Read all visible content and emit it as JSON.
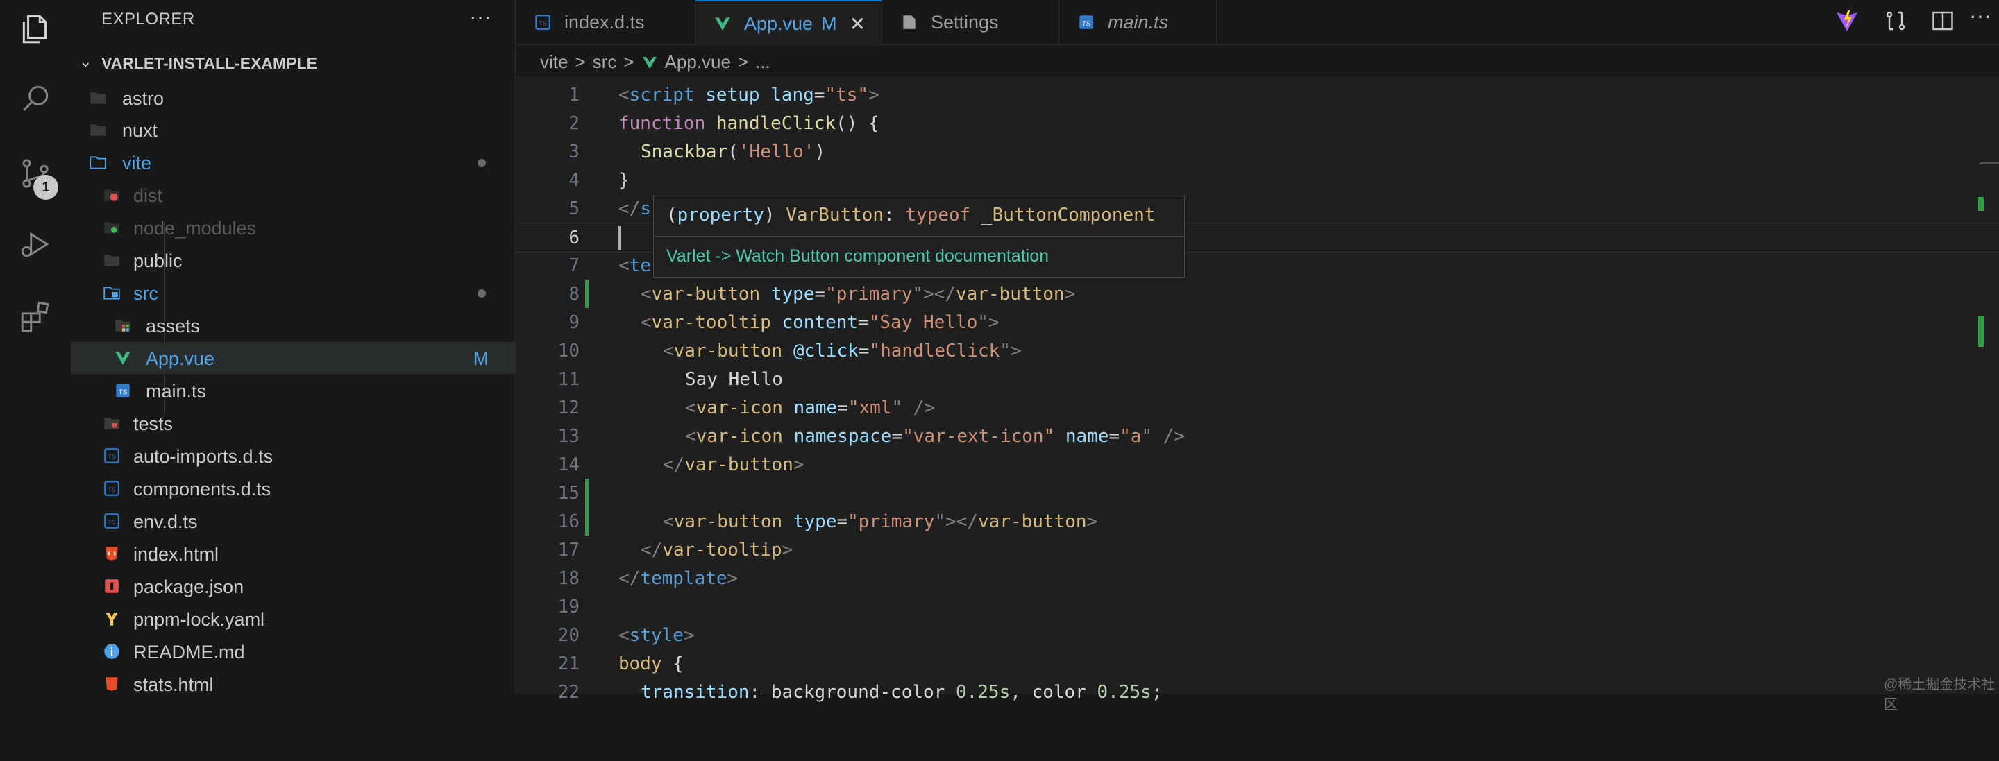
{
  "sidebar": {
    "title": "EXPLORER",
    "more": "···",
    "project": "VARLET-INSTALL-EXAMPLE",
    "items": [
      {
        "label": "astro",
        "icon": "folder-icon"
      },
      {
        "label": "nuxt",
        "icon": "folder-icon"
      },
      {
        "label": "vite",
        "icon": "folder-open-icon",
        "modified": true
      },
      {
        "label": "dist",
        "icon": "folder-dist-icon"
      },
      {
        "label": "node_modules",
        "icon": "folder-node-icon"
      },
      {
        "label": "public",
        "icon": "folder-icon"
      },
      {
        "label": "src",
        "icon": "folder-src-icon",
        "modified": true
      },
      {
        "label": "assets",
        "icon": "folder-assets-icon"
      },
      {
        "label": "App.vue",
        "icon": "vue-icon",
        "status": "M"
      },
      {
        "label": "main.ts",
        "icon": "ts-icon"
      },
      {
        "label": "tests",
        "icon": "folder-tests-icon"
      },
      {
        "label": "auto-imports.d.ts",
        "icon": "ts-icon"
      },
      {
        "label": "components.d.ts",
        "icon": "ts-icon"
      },
      {
        "label": "env.d.ts",
        "icon": "ts-icon"
      },
      {
        "label": "index.html",
        "icon": "html-icon"
      },
      {
        "label": "package.json",
        "icon": "json-icon"
      },
      {
        "label": "pnpm-lock.yaml",
        "icon": "yaml-icon"
      },
      {
        "label": "README.md",
        "icon": "info-icon"
      },
      {
        "label": "stats.html",
        "icon": "html-icon"
      }
    ]
  },
  "activity": {
    "scm_badge": "1"
  },
  "tabs": [
    {
      "label": "index.d.ts",
      "icon": "ts-icon"
    },
    {
      "label": "App.vue",
      "icon": "vue-icon",
      "status": "M",
      "close": "✕"
    },
    {
      "label": "Settings",
      "icon": "settings-file-icon"
    },
    {
      "label": "main.ts",
      "icon": "ts-icon"
    }
  ],
  "breadcrumb": {
    "a": "vite",
    "b": "src",
    "c": "App.vue",
    "d": "...",
    "sep": ">"
  },
  "editor": {
    "line_numbers": [
      "1",
      "2",
      "3",
      "4",
      "5",
      "6",
      "7",
      "8",
      "9",
      "10",
      "11",
      "12",
      "13",
      "14",
      "15",
      "16",
      "17",
      "18",
      "19",
      "20",
      "21",
      "22"
    ],
    "current_line": "6"
  },
  "hover": {
    "sig_paren_open": "(",
    "sig_kind": "property",
    "sig_paren_close": ")",
    "sig_name": "VarButton",
    "sig_colon": ":",
    "sig_typeof": "typeof",
    "sig_type": "_ButtonComponent",
    "link": "Varlet -> Watch Button component documentation"
  },
  "code": {
    "l1": {
      "open": "<",
      "tag": "script",
      "a1": "setup",
      "a2": "lang",
      "eq": "=",
      "q1": "\"",
      "v": "ts",
      "q2": "\"",
      "close": ">"
    },
    "l2": {
      "kw": "function",
      "fn": "handleClick",
      "p": "() {"
    },
    "l3": {
      "fn": "Snackbar",
      "p1": "(",
      "s": "'Hello'",
      "p2": ")"
    },
    "l4": {
      "p": "}"
    },
    "l5": {
      "open": "</",
      "tag": "s"
    },
    "l7": {
      "open": "<",
      "tag": "te"
    },
    "l8": {
      "o": "<",
      "tag": "var-button",
      "attr": "type",
      "eq": "=",
      "q": "\"",
      "val": "primary",
      "m": "\"></",
      "tag2": "var-button",
      "c": ">"
    },
    "l9": {
      "o": "<",
      "tag": "var-tooltip",
      "attr": "content",
      "eq": "=",
      "q": "\"",
      "val": "Say Hello",
      "c": "\">"
    },
    "l10": {
      "o": "<",
      "tag": "var-button",
      "attr": "@click",
      "eq": "=",
      "q": "\"",
      "val": "handleClick",
      "c": "\">"
    },
    "l11": {
      "text": "Say Hello"
    },
    "l12": {
      "o": "<",
      "tag": "var-icon",
      "attr": "name",
      "eq": "=",
      "q": "\"",
      "val": "xml",
      "c": "\" />"
    },
    "l13": {
      "o": "<",
      "tag": "var-icon",
      "attr": "namespace",
      "eq": "=",
      "q": "\"",
      "val": "var-ext-icon",
      "q2": "\"",
      "attr2": "name",
      "eq2": "=",
      "q3": "\"",
      "val2": "a",
      "c": "\" />"
    },
    "l14": {
      "o": "</",
      "tag": "var-button",
      "c": ">"
    },
    "l16": {
      "o": "<",
      "tag": "var-button",
      "attr": "type",
      "eq": "=",
      "q": "\"",
      "val": "primary",
      "m": "\"></",
      "tag2": "var-button",
      "c": ">"
    },
    "l17": {
      "o": "</",
      "tag": "var-tooltip",
      "c": ">"
    },
    "l18": {
      "o": "</",
      "tag": "template",
      "c": ">"
    },
    "l20": {
      "o": "<",
      "tag": "style",
      "c": ">"
    },
    "l21": {
      "sel": "body",
      "p": " {"
    },
    "l22": {
      "prop": "transition",
      "colon": ": ",
      "v1": "background-color",
      "n1": "0.25s",
      "comma": ", ",
      "v2": "color",
      "n2": "0.25s",
      "semi": ";"
    }
  },
  "watermark": "@稀土掘金技术社区"
}
